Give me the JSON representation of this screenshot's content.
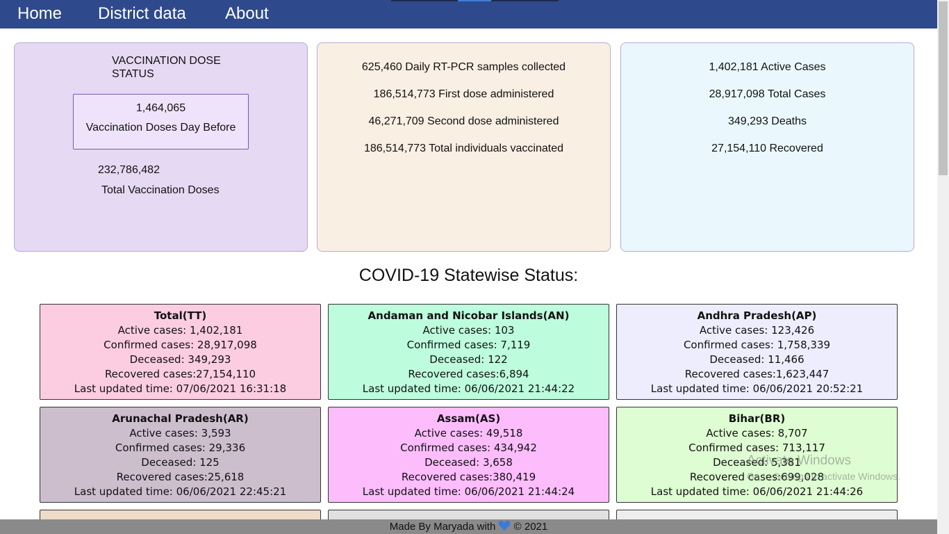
{
  "nav": {
    "home": "Home",
    "district": "District data",
    "about": "About"
  },
  "vaccination": {
    "title": "VACCINATION DOSE STATUS",
    "day_before_value": "1,464,065",
    "day_before_label": "Vaccination Doses Day Before",
    "total_value": "232,786,482",
    "total_label": "Total Vaccination Doses"
  },
  "doses": {
    "samples": "625,460 Daily RT-PCR samples collected",
    "first_dose": "186,514,773 First dose administered",
    "second_dose": "46,271,709 Second dose administered",
    "total_vaccinated": "186,514,773 Total individuals vaccinated"
  },
  "cases": {
    "active": "1,402,181 Active Cases",
    "total": "28,917,098 Total Cases",
    "deaths": "349,293 Deaths",
    "recovered": "27,154,110 Recovered"
  },
  "section_title": "COVID-19 Statewise Status:",
  "states": [
    {
      "name": "Total(TT)",
      "active": "Active cases: 1,402,181",
      "confirmed": "Confirmed cases: 28,917,098",
      "deceased": "Deceased: 349,293",
      "recovered": "Recovered cases:27,154,110",
      "updated": "Last updated time: 07/06/2021 16:31:18",
      "color": "#fccde0"
    },
    {
      "name": "Andaman and Nicobar Islands(AN)",
      "active": "Active cases: 103",
      "confirmed": "Confirmed cases: 7,119",
      "deceased": "Deceased: 122",
      "recovered": "Recovered cases:6,894",
      "updated": "Last updated time: 06/06/2021 21:44:22",
      "color": "#bdfddd"
    },
    {
      "name": "Andhra Pradesh(AP)",
      "active": "Active cases: 123,426",
      "confirmed": "Confirmed cases: 1,758,339",
      "deceased": "Deceased: 11,466",
      "recovered": "Recovered cases:1,623,447",
      "updated": "Last updated time: 06/06/2021 20:52:21",
      "color": "#eeedfe"
    },
    {
      "name": "Arunachal Pradesh(AR)",
      "active": "Active cases: 3,593",
      "confirmed": "Confirmed cases: 29,336",
      "deceased": "Deceased: 125",
      "recovered": "Recovered cases:25,618",
      "updated": "Last updated time: 06/06/2021 22:45:21",
      "color": "#cdbece"
    },
    {
      "name": "Assam(AS)",
      "active": "Active cases: 49,518",
      "confirmed": "Confirmed cases: 434,942",
      "deceased": "Deceased: 3,658",
      "recovered": "Recovered cases:380,419",
      "updated": "Last updated time: 06/06/2021 21:44:24",
      "color": "#fdbdfd"
    },
    {
      "name": "Bihar(BR)",
      "active": "Active cases: 8,707",
      "confirmed": "Confirmed cases: 713,117",
      "deceased": "Deceased: 5,381",
      "recovered": "Recovered cases:699,028",
      "updated": "Last updated time: 06/06/2021 21:44:26",
      "color": "#defdd2"
    }
  ],
  "partial_cards": [
    {
      "color": "#ecdcc8"
    },
    {
      "color": "#e0e0e0"
    },
    {
      "color": "#eeeeee"
    }
  ],
  "footer": {
    "made_by": "Made By Maryada with",
    "copyright": "© 2021",
    "heart_color": "#3a7bd5"
  },
  "watermark": {
    "title": "Activate Windows",
    "sub": "Go to Settings to activate Windows."
  }
}
